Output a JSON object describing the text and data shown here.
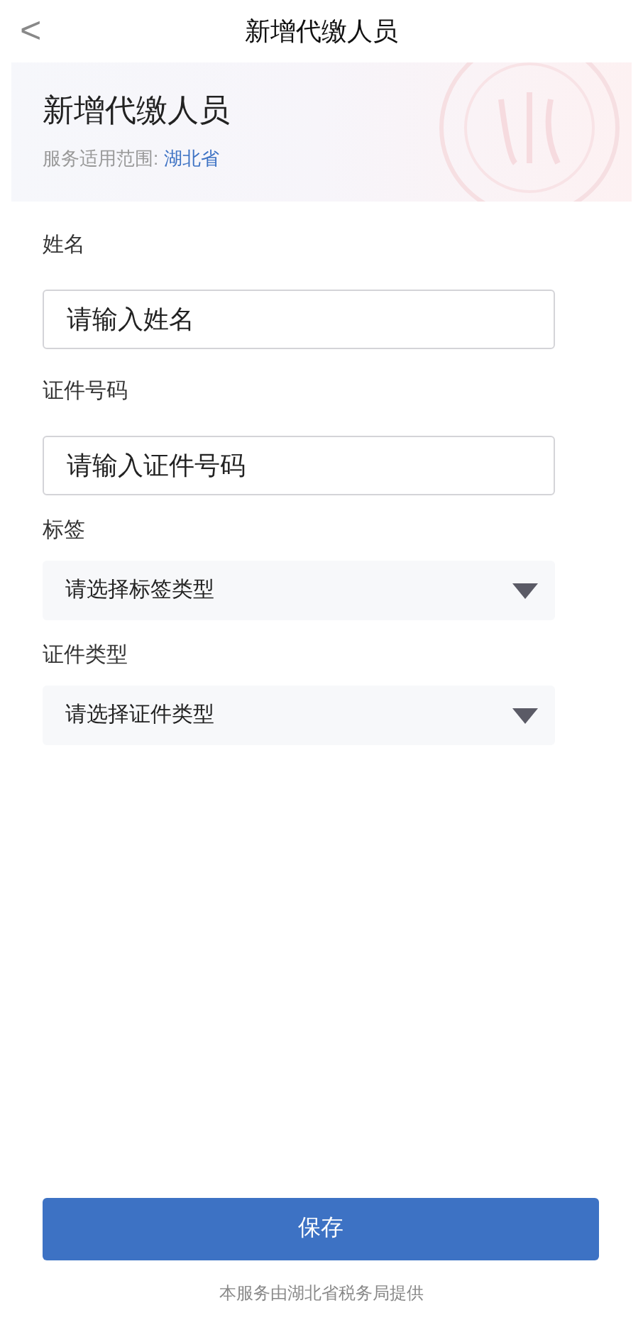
{
  "nav": {
    "back": "<",
    "title": "新增代缴人员"
  },
  "banner": {
    "title": "新增代缴人员",
    "scope_label": "服务适用范围:",
    "scope_value": "湖北省"
  },
  "fields": [
    {
      "kind": "input",
      "label": "姓名",
      "placeholder": "请输入姓名"
    },
    {
      "kind": "input",
      "label": "证件号码",
      "placeholder": "请输入证件号码"
    },
    {
      "kind": "select",
      "label": "标签",
      "placeholder": "请选择标签类型"
    },
    {
      "kind": "select",
      "label": "证件类型",
      "placeholder": "请选择证件类型"
    }
  ],
  "save_button": "保存",
  "footer": "本服务由湖北省税务局提供"
}
